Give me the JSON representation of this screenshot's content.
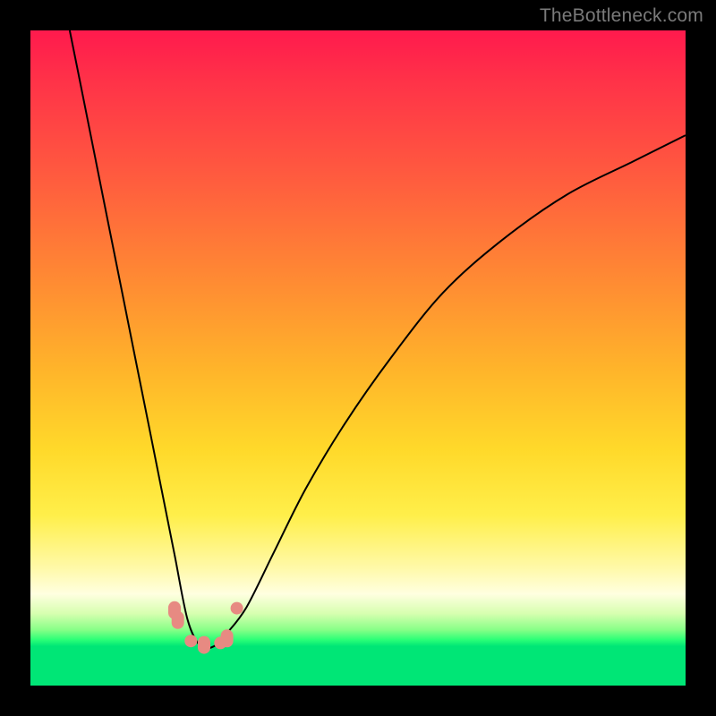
{
  "watermark": "TheBottleneck.com",
  "colors": {
    "background_frame": "#000000",
    "gradient_top": "#ff1a4d",
    "gradient_mid": "#ffd92a",
    "gradient_bottom": "#00e676",
    "curve": "#000000",
    "marker": "#e78a82"
  },
  "chart_data": {
    "type": "line",
    "title": "",
    "xlabel": "",
    "ylabel": "",
    "xlim": [
      0,
      100
    ],
    "ylim": [
      0,
      100
    ],
    "note": "Axes are unlabeled; values estimated from pixel positions. y=100 at top, y=0 at bottom. Curve is an asymmetric V / bottleneck profile with minimum near x≈26.",
    "series": [
      {
        "name": "bottleneck-curve",
        "x": [
          6,
          8,
          10,
          12,
          14,
          16,
          18,
          20,
          22,
          24,
          26,
          28,
          30,
          33,
          37,
          42,
          48,
          55,
          63,
          72,
          82,
          92,
          100
        ],
        "y": [
          100,
          90,
          80,
          70,
          60,
          50,
          40,
          30,
          20,
          10,
          6,
          6,
          8,
          12,
          20,
          30,
          40,
          50,
          60,
          68,
          75,
          80,
          84
        ]
      }
    ],
    "markers": [
      {
        "shape": "rounded",
        "x": 22.0,
        "y": 11.5
      },
      {
        "shape": "rounded",
        "x": 22.5,
        "y": 10.0
      },
      {
        "shape": "circle",
        "x": 24.5,
        "y": 6.8
      },
      {
        "shape": "rounded",
        "x": 26.5,
        "y": 6.2
      },
      {
        "shape": "circle",
        "x": 29.0,
        "y": 6.5
      },
      {
        "shape": "rounded",
        "x": 30.0,
        "y": 7.2
      },
      {
        "shape": "circle",
        "x": 31.5,
        "y": 11.8
      }
    ]
  }
}
